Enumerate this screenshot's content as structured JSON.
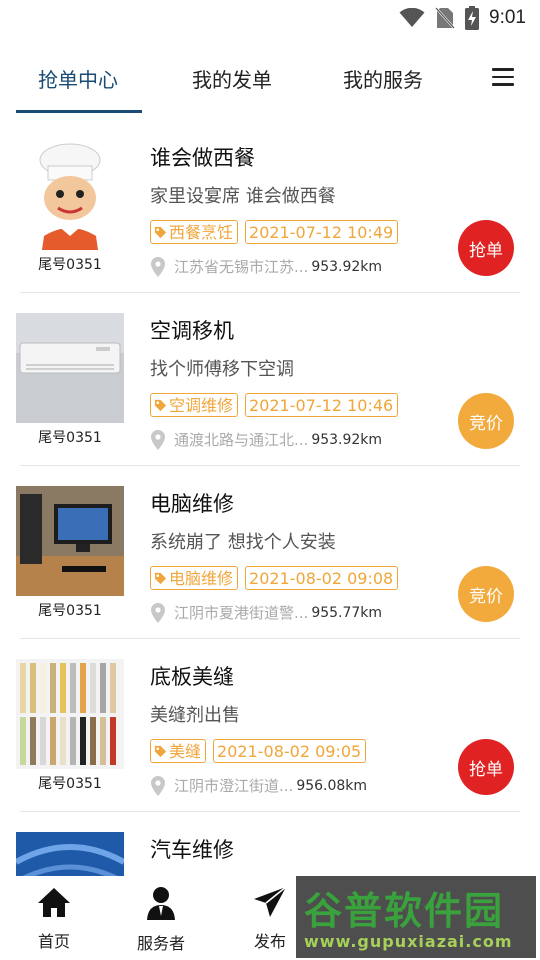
{
  "status": {
    "time": "9:01"
  },
  "tabs": [
    {
      "label": "抢单中心"
    },
    {
      "label": "我的发单"
    },
    {
      "label": "我的服务"
    }
  ],
  "items": [
    {
      "title": "谁会做西餐",
      "desc": "家里设宴席 谁会做西餐",
      "tag": "西餐烹饪",
      "time": "2021-07-12 10:49",
      "address": "江苏省无锡市江苏...",
      "distance": "953.92km",
      "tail": "尾号0351",
      "action": "抢单",
      "action_color": "#e02222"
    },
    {
      "title": "空调移机",
      "desc": "找个师傅移下空调",
      "tag": "空调维修",
      "time": "2021-07-12 10:46",
      "address": "通渡北路与通江北...",
      "distance": "953.92km",
      "tail": "尾号0351",
      "action": "竞价",
      "action_color": "#f3aa3d"
    },
    {
      "title": "电脑维修",
      "desc": "系统崩了 想找个人安装",
      "tag": "电脑维修",
      "time": "2021-08-02 09:08",
      "address": "江阴市夏港街道警...",
      "distance": "955.77km",
      "tail": "尾号0351",
      "action": "竞价",
      "action_color": "#f3aa3d"
    },
    {
      "title": "底板美缝",
      "desc": "美缝剂出售",
      "tag": "美缝",
      "time": "2021-08-02 09:05",
      "address": "江阴市澄江街道...",
      "distance": "956.08km",
      "tail": "尾号0351",
      "action": "抢单",
      "action_color": "#e02222"
    },
    {
      "title": "汽车维修",
      "desc": "",
      "tag": "",
      "time": "",
      "address": "",
      "distance": "",
      "tail": "",
      "action": "",
      "action_color": ""
    }
  ],
  "bottom_nav": [
    {
      "label": "首页",
      "icon": "home-icon"
    },
    {
      "label": "服务者",
      "icon": "person-icon"
    },
    {
      "label": "发布",
      "icon": "send-icon"
    }
  ],
  "watermark": {
    "line1": "谷普软件园",
    "line2": "www.gupuxiazai.com"
  }
}
